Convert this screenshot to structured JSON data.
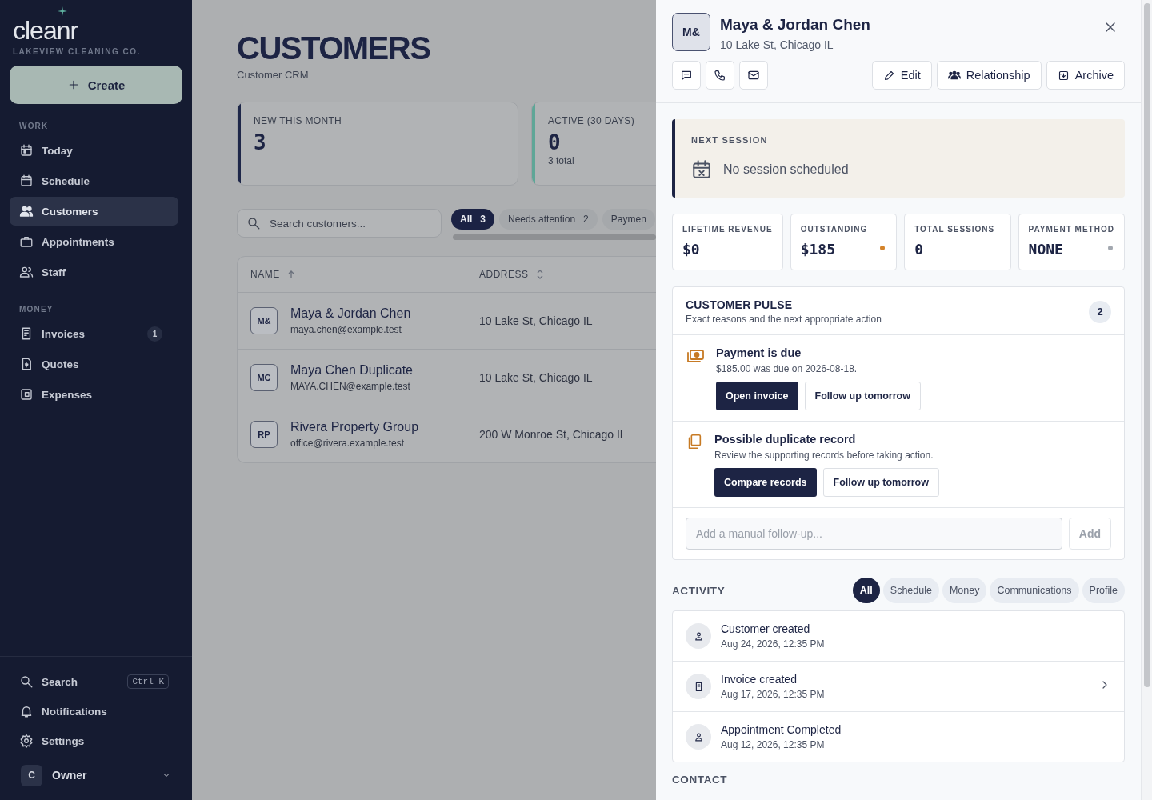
{
  "sidebar": {
    "logo": "cleanr",
    "company": "LAKEVIEW CLEANING CO.",
    "create_button": "Create",
    "sections": [
      {
        "title": "WORK",
        "items": [
          {
            "label": "Today",
            "selected": false
          },
          {
            "label": "Schedule",
            "selected": false
          },
          {
            "label": "Customers",
            "selected": true
          },
          {
            "label": "Appointments",
            "selected": false
          },
          {
            "label": "Staff",
            "selected": false
          }
        ]
      },
      {
        "title": "MONEY",
        "items": [
          {
            "label": "Invoices",
            "selected": false,
            "badge": "1"
          },
          {
            "label": "Quotes",
            "selected": false
          },
          {
            "label": "Expenses",
            "selected": false
          }
        ]
      }
    ],
    "footer_items": [
      {
        "label": "Search",
        "shortcut": "Ctrl K"
      },
      {
        "label": "Notifications"
      },
      {
        "label": "Settings"
      }
    ],
    "user": {
      "initial": "C",
      "name": "Owner"
    }
  },
  "main": {
    "title": "CUSTOMERS",
    "subtitle": "Customer CRM",
    "stats": [
      {
        "label": "NEW THIS MONTH",
        "value": "3",
        "color": "#1e2749"
      },
      {
        "label": "ACTIVE (30 DAYS)",
        "value": "0",
        "note": "3 total",
        "color": "#5fa697"
      }
    ],
    "search": {
      "placeholder": "Search customers..."
    },
    "filters": [
      {
        "label": "All",
        "count": "3",
        "selected": true
      },
      {
        "label": "Needs attention",
        "count": "2",
        "selected": false
      },
      {
        "label": "Paymen",
        "selected": false
      }
    ],
    "table": {
      "columns": [
        {
          "label": "NAME",
          "sorted": true
        },
        {
          "label": "ADDRESS",
          "sorted": false
        }
      ],
      "rows": [
        {
          "initials": "M&",
          "name": "Maya & Jordan Chen",
          "email": "maya.chen@example.test",
          "address": "10 Lake St, Chicago IL"
        },
        {
          "initials": "MC",
          "name": "Maya Chen Duplicate",
          "email": "MAYA.CHEN@example.test",
          "address": "10 Lake St, Chicago IL"
        },
        {
          "initials": "RP",
          "name": "Rivera Property Group",
          "email": "office@rivera.example.test",
          "address": "200 W Monroe St, Chicago IL"
        }
      ]
    }
  },
  "drawer": {
    "initials": "M&",
    "name": "Maya & Jordan Chen",
    "address": "10 Lake St, Chicago IL",
    "actions": [
      "Edit",
      "Relationship",
      "Archive"
    ],
    "next_session": {
      "title": "NEXT SESSION",
      "text": "No session scheduled"
    },
    "metrics": [
      {
        "label": "LIFETIME REVENUE",
        "value": "$0"
      },
      {
        "label": "OUTSTANDING",
        "value": "$185",
        "color": "#d4832a"
      },
      {
        "label": "TOTAL SESSIONS",
        "value": "0"
      },
      {
        "label": "PAYMENT METHOD",
        "value": "NONE",
        "color": "#a3a8b0"
      }
    ],
    "pulse": {
      "title": "CUSTOMER PULSE",
      "subtitle": "Exact reasons and the next appropriate action",
      "count": "2",
      "items": [
        {
          "title": "Payment is due",
          "text": "$185.00 was due on 2026-08-18.",
          "primary": "Open invoice",
          "secondary": "Follow up tomorrow"
        },
        {
          "title": "Possible duplicate record",
          "text": "Review the supporting records before taking action.",
          "primary": "Compare records",
          "secondary": "Follow up tomorrow"
        }
      ],
      "input": {
        "placeholder": "Add a manual follow-up..."
      },
      "add_button": {
        "label": "Add",
        "disabled": true
      }
    },
    "activity": {
      "title": "ACTIVITY",
      "filters": [
        {
          "label": "All",
          "selected": true
        },
        {
          "label": "Schedule",
          "selected": false
        },
        {
          "label": "Money",
          "selected": false
        },
        {
          "label": "Communications",
          "selected": false
        },
        {
          "label": "Profile",
          "selected": false
        }
      ],
      "events": [
        {
          "title": "Customer created",
          "time": "Aug 24, 2026, 12:35 PM",
          "linked": false
        },
        {
          "title": "Invoice created",
          "time": "Aug 17, 2026, 12:35 PM",
          "linked": true
        },
        {
          "title": "Appointment Completed",
          "time": "Aug 12, 2026, 12:35 PM",
          "linked": false
        }
      ]
    },
    "contact_title": "CONTACT"
  }
}
